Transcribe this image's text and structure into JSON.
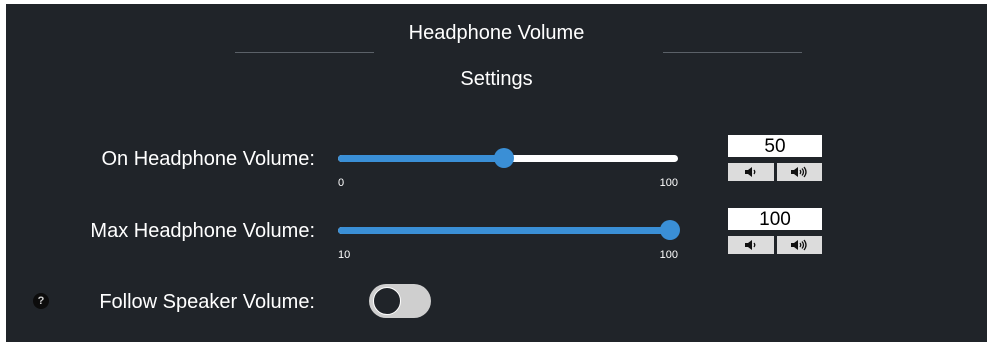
{
  "header": {
    "title_line1": "Headphone Volume",
    "title_line2": "Settings"
  },
  "colors": {
    "panel_bg": "#202429",
    "accent": "#3a8fd6",
    "track": "#ffffff"
  },
  "on_volume": {
    "label": "On Headphone Volume:",
    "min": 0,
    "max": 100,
    "value": 50,
    "min_label": "0",
    "max_label": "100",
    "value_text": "50",
    "decrease_icon": "volume-down-icon",
    "increase_icon": "volume-up-icon"
  },
  "max_volume": {
    "label": "Max Headphone Volume:",
    "min": 10,
    "max": 100,
    "value": 100,
    "min_label": "10",
    "max_label": "100",
    "value_text": "100",
    "decrease_icon": "volume-down-icon",
    "increase_icon": "volume-up-icon"
  },
  "follow_speaker": {
    "label": "Follow Speaker Volume:",
    "help_text": "?",
    "enabled": false
  }
}
